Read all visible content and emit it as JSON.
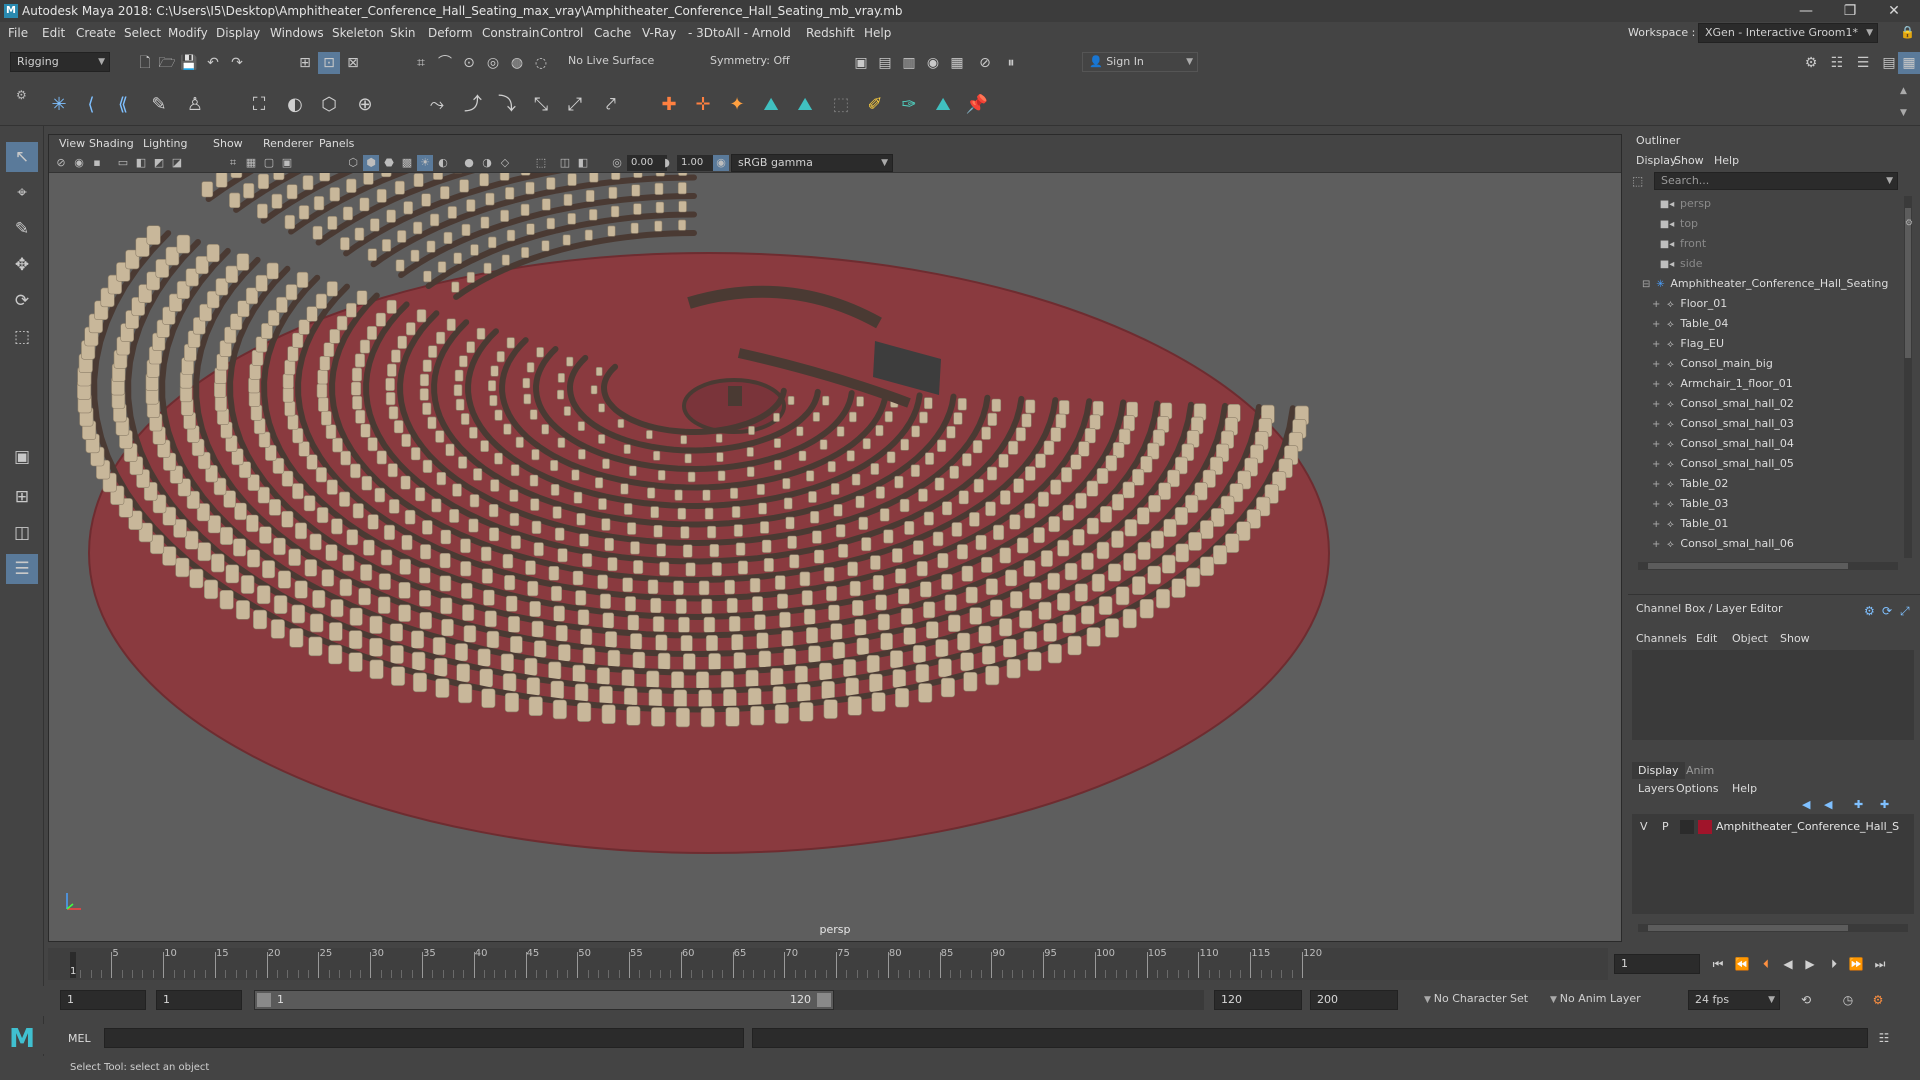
{
  "app": {
    "title": "Autodesk Maya 2018: C:\\Users\\I5\\Desktop\\Amphitheater_Conference_Hall_Seating_max_vray\\Amphitheater_Conference_Hall_Seating_mb_vray.mb",
    "workspace_label": "Workspace :",
    "workspace_value": "XGen - Interactive Groom1*"
  },
  "menus": [
    "File",
    "Edit",
    "Create",
    "Select",
    "Modify",
    "Display",
    "Windows",
    "Skeleton",
    "Skin",
    "Deform",
    "Constrain",
    "Control",
    "Cache",
    "V-Ray",
    "- 3DtoAll -",
    "Arnold",
    "Redshift",
    "Help"
  ],
  "statusline": {
    "menuset": "Rigging",
    "live_surface": "No Live Surface",
    "symmetry": "Symmetry: Off",
    "sign_in": "Sign In"
  },
  "viewport": {
    "menus": [
      "View",
      "Shading",
      "Lighting",
      "Show",
      "Renderer",
      "Panels"
    ],
    "exposure": "0.00",
    "gamma": "1.00",
    "color_space": "sRGB gamma",
    "camera_label": "persp"
  },
  "outliner": {
    "title": "Outliner",
    "menus": [
      "Display",
      "Show",
      "Help"
    ],
    "search_placeholder": "Search...",
    "items": [
      {
        "label": "persp",
        "dim": true,
        "indent": 1
      },
      {
        "label": "top",
        "dim": true,
        "indent": 1
      },
      {
        "label": "front",
        "dim": true,
        "indent": 1
      },
      {
        "label": "side",
        "dim": true,
        "indent": 1
      },
      {
        "label": "Amphitheater_Conference_Hall_Seating",
        "dim": false,
        "indent": 0
      },
      {
        "label": "Floor_01",
        "dim": false,
        "indent": 2
      },
      {
        "label": "Table_04",
        "dim": false,
        "indent": 2
      },
      {
        "label": "Flag_EU",
        "dim": false,
        "indent": 2
      },
      {
        "label": "Consol_main_big",
        "dim": false,
        "indent": 2
      },
      {
        "label": "Armchair_1_floor_01",
        "dim": false,
        "indent": 2
      },
      {
        "label": "Consol_smal_hall_02",
        "dim": false,
        "indent": 2
      },
      {
        "label": "Consol_smal_hall_03",
        "dim": false,
        "indent": 2
      },
      {
        "label": "Consol_smal_hall_04",
        "dim": false,
        "indent": 2
      },
      {
        "label": "Consol_smal_hall_05",
        "dim": false,
        "indent": 2
      },
      {
        "label": "Table_02",
        "dim": false,
        "indent": 2
      },
      {
        "label": "Table_03",
        "dim": false,
        "indent": 2
      },
      {
        "label": "Table_01",
        "dim": false,
        "indent": 2
      },
      {
        "label": "Consol_smal_hall_06",
        "dim": false,
        "indent": 2
      }
    ]
  },
  "channel_box": {
    "title": "Channel Box / Layer Editor",
    "menus": [
      "Channels",
      "Edit",
      "Object",
      "Show"
    ]
  },
  "layer_editor": {
    "tabs": [
      "Display",
      "Anim"
    ],
    "menus": [
      "Layers",
      "Options",
      "Help"
    ],
    "layer": {
      "v": "V",
      "p": "P",
      "name": "Amphitheater_Conference_Hall_S",
      "color": "#a0142a"
    }
  },
  "timeline": {
    "start": 1,
    "end": 120,
    "labels": [
      "5",
      "10",
      "15",
      "20",
      "25",
      "30",
      "35",
      "40",
      "45",
      "50",
      "55",
      "60",
      "65",
      "70",
      "75",
      "80",
      "85",
      "90",
      "95",
      "100",
      "105",
      "110",
      "115",
      "120"
    ],
    "current_frame": "1",
    "current_label": "1"
  },
  "range": {
    "start": "1",
    "playback_start": "1",
    "slider_start": "1",
    "slider_end": "120",
    "playback_end": "120",
    "end": "200",
    "character_set": "No Character Set",
    "anim_layer": "No Anim Layer",
    "fps": "24 fps"
  },
  "command": {
    "lang": "MEL",
    "help": "Select Tool: select an object"
  },
  "colors": {
    "floor": "#8a3a3f",
    "seat": "#c8b79a",
    "desk": "#4a3a33"
  }
}
